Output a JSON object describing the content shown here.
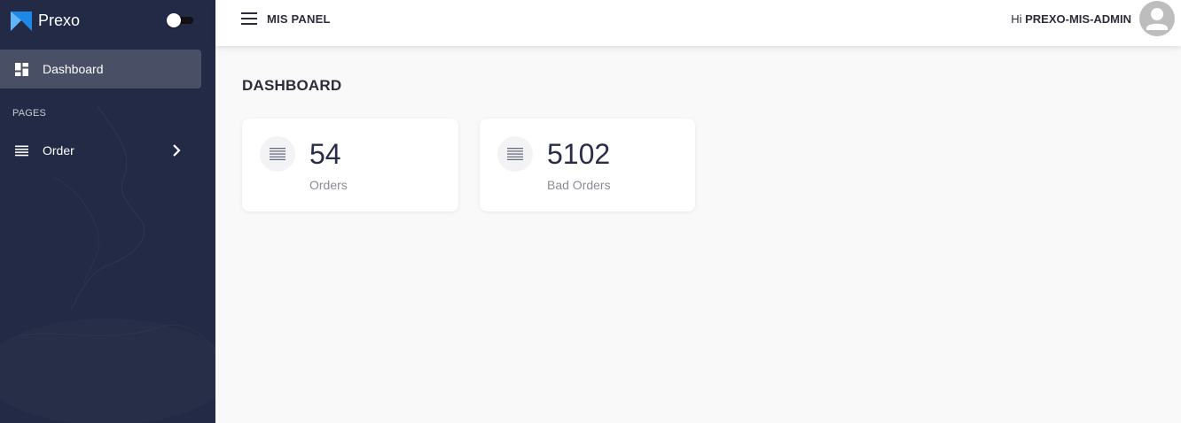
{
  "brand": {
    "name": "Prexo",
    "accent": "#1e88e5"
  },
  "sidebar": {
    "toggle_state": "off",
    "active_item": {
      "label": "Dashboard",
      "icon": "dashboard-icon"
    },
    "section_label": "PAGES",
    "items": [
      {
        "label": "Order",
        "icon": "list-icon",
        "trailing_icon": "chevron-right-icon"
      }
    ],
    "background": "#222a45"
  },
  "topbar": {
    "title": "MIS PANEL",
    "greeting_prefix": "Hi",
    "username": "PREXO-MIS-ADMIN"
  },
  "main": {
    "page_title": "DASHBOARD",
    "cards": [
      {
        "value": "54",
        "label": "Orders",
        "icon": "list-icon"
      },
      {
        "value": "5102",
        "label": "Bad Orders",
        "icon": "list-icon"
      }
    ]
  }
}
